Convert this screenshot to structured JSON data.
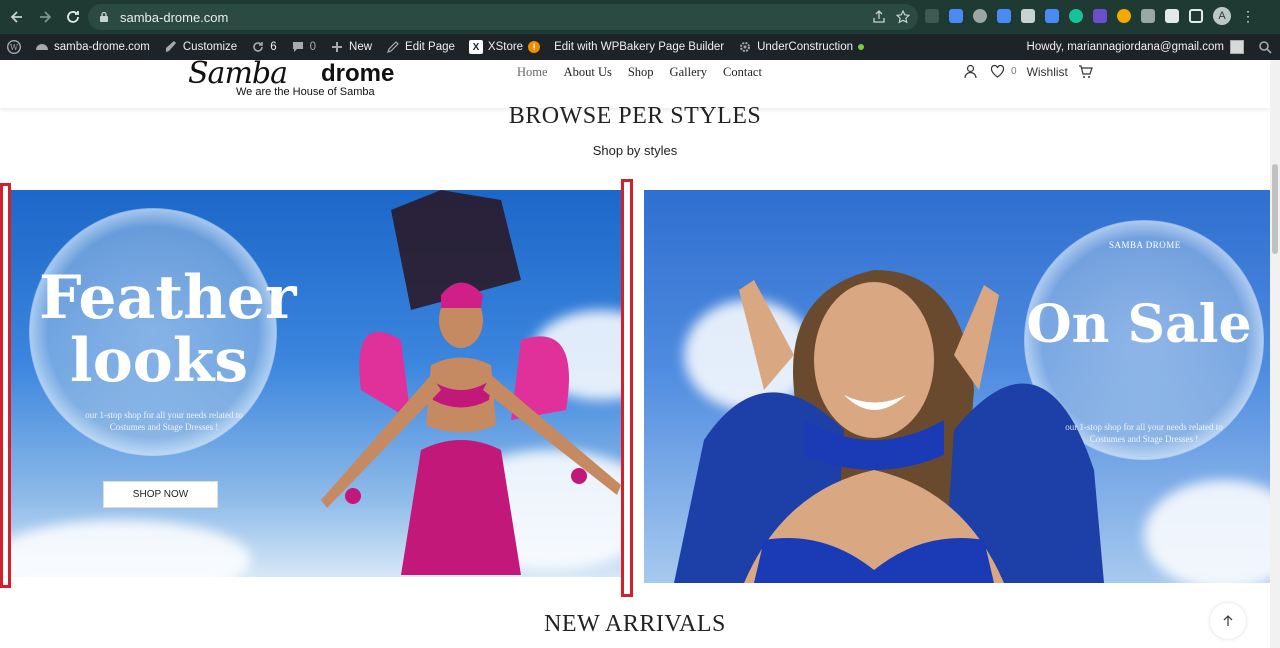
{
  "browser": {
    "url": "samba-drome.com"
  },
  "wp_admin_bar": {
    "site_name": "samba-drome.com",
    "customize": "Customize",
    "updates_count": "6",
    "comments_count": "0",
    "new": "New",
    "edit_page": "Edit Page",
    "xstore": "XStore",
    "wpbakery": "Edit with WPBakery Page Builder",
    "under_construction": "UnderConstruction",
    "howdy": "Howdy, mariannagiordana@gmail.com"
  },
  "header": {
    "logo_script": "Samba",
    "logo_bold": "drome",
    "tagline": "We are the House of Samba",
    "nav": [
      "Home",
      "About Us",
      "Shop",
      "Gallery",
      "Contact"
    ],
    "wishlist_count": "0",
    "wishlist_label": "Wishlist"
  },
  "browse": {
    "title": "BROWSE PER STYLES",
    "subtitle": "Shop by styles"
  },
  "banner_left": {
    "line1": "Feather",
    "line2": "looks",
    "small_line1": "our 1-stop shop for all your needs related to",
    "small_line2": "Costumes and Stage Dresses !",
    "button": "SHOP NOW"
  },
  "banner_right": {
    "brand": "SAMBA DROME",
    "headline": "On Sale",
    "small_line1": "our 1-stop shop for all your needs related to",
    "small_line2": "Costumes and Stage Dresses !"
  },
  "new_arrivals": {
    "title": "NEW ARRIVALS"
  },
  "colors": {
    "chrome_bar": "#1f3a33",
    "wp_bar": "#1d2327",
    "accent_red": "#d4202a"
  }
}
